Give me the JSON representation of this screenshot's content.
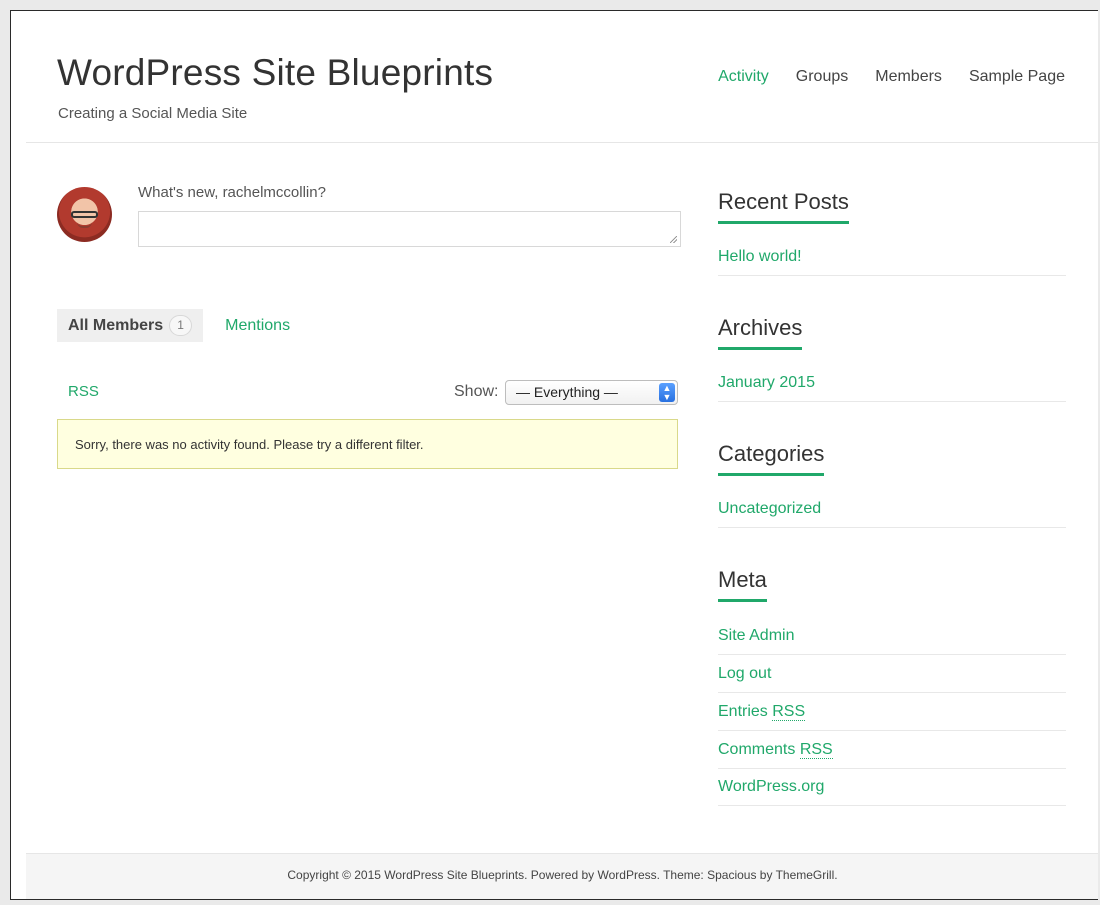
{
  "header": {
    "site_title": "WordPress Site Blueprints",
    "site_description": "Creating a Social Media Site",
    "nav": [
      {
        "label": "Activity",
        "active": true
      },
      {
        "label": "Groups",
        "active": false
      },
      {
        "label": "Members",
        "active": false
      },
      {
        "label": "Sample Page",
        "active": false
      }
    ]
  },
  "activity": {
    "whats_new": "What's new, rachelmccollin?",
    "status_value": "",
    "tabs": {
      "all_members_label": "All Members",
      "all_members_count": "1",
      "mentions_label": "Mentions"
    },
    "rss_label": "RSS",
    "show_label": "Show:",
    "filter_selected": "— Everything —",
    "notice": "Sorry, there was no activity found. Please try a different filter."
  },
  "sidebar": {
    "recent_posts": {
      "title": "Recent Posts",
      "items": [
        "Hello world!"
      ]
    },
    "archives": {
      "title": "Archives",
      "items": [
        "January 2015"
      ]
    },
    "categories": {
      "title": "Categories",
      "items": [
        "Uncategorized"
      ]
    },
    "meta": {
      "title": "Meta",
      "items": [
        "Site Admin",
        "Log out",
        "Entries",
        "Comments",
        "WordPress.org"
      ],
      "rss_abbr": "RSS"
    }
  },
  "footer": {
    "text": "Copyright © 2015 WordPress Site Blueprints. Powered by WordPress. Theme: Spacious by ThemeGrill."
  },
  "colors": {
    "accent": "#20a86a",
    "notice_bg": "#ffffe0"
  }
}
